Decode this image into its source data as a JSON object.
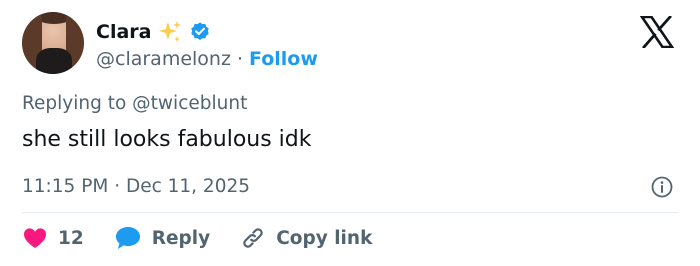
{
  "author": {
    "name": "Clara",
    "handle": "@claramelonz",
    "separator": "·",
    "follow_label": "Follow"
  },
  "tweet": {
    "replying_to": "Replying to @twiceblunt",
    "text": "she still looks fabulous idk",
    "timestamp": "11:15 PM · Dec 11, 2025"
  },
  "actions": {
    "like_count": "12",
    "reply_label": "Reply",
    "copy_link_label": "Copy link"
  },
  "colors": {
    "accent": "#1d9bf0",
    "like": "#f91880",
    "muted": "#536471",
    "text": "#0f1419",
    "sparkle": "#ffcc4d"
  },
  "icons": [
    "sparkles-icon",
    "verified-badge-icon",
    "x-logo-icon",
    "info-icon",
    "heart-icon",
    "reply-bubble-icon",
    "link-icon"
  ]
}
